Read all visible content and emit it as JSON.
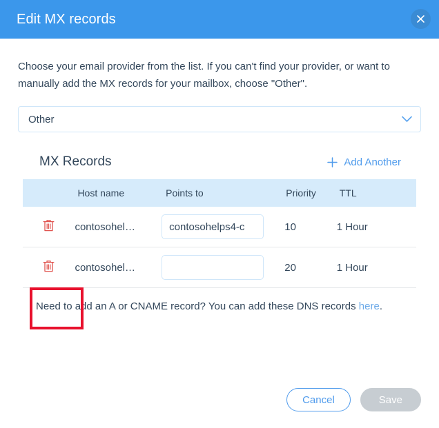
{
  "header": {
    "title": "Edit MX records",
    "close_icon": "close-icon"
  },
  "intro": {
    "text": "Choose your email provider from the list. If you can't find your provider, or want to manually add the MX records for your mailbox, choose \"Other\"."
  },
  "provider_select": {
    "value": "Other",
    "chevron_icon": "chevron-down-icon"
  },
  "records": {
    "title": "MX Records",
    "add_another_label": "Add Another",
    "plus_icon": "plus-icon",
    "columns": [
      "",
      "Host name",
      "Points to",
      "Priority",
      "TTL"
    ],
    "rows": [
      {
        "delete_icon": "trash-icon",
        "host_name": "contosohel…",
        "points_to": "contosohelps4-c",
        "points_to_placeholder": "",
        "priority": "10",
        "ttl": "1 Hour"
      },
      {
        "delete_icon": "trash-icon",
        "host_name": "contosohel…",
        "points_to": "",
        "points_to_placeholder": "",
        "priority": "20",
        "ttl": "1 Hour"
      }
    ]
  },
  "footer_note": {
    "text_before": "Need to add an A or CNAME record? You can add these DNS records ",
    "link_label": "here",
    "text_after": "."
  },
  "actions": {
    "cancel_label": "Cancel",
    "save_label": "Save"
  },
  "colors": {
    "header_blue": "#3b97eb",
    "accent_blue": "#4f9bec",
    "table_header_blue": "#d6ebfb",
    "trash_red": "#e0534e",
    "annotation_red": "#e8112d",
    "save_disabled_gray": "#c7cdd2",
    "text": "#33475b"
  }
}
